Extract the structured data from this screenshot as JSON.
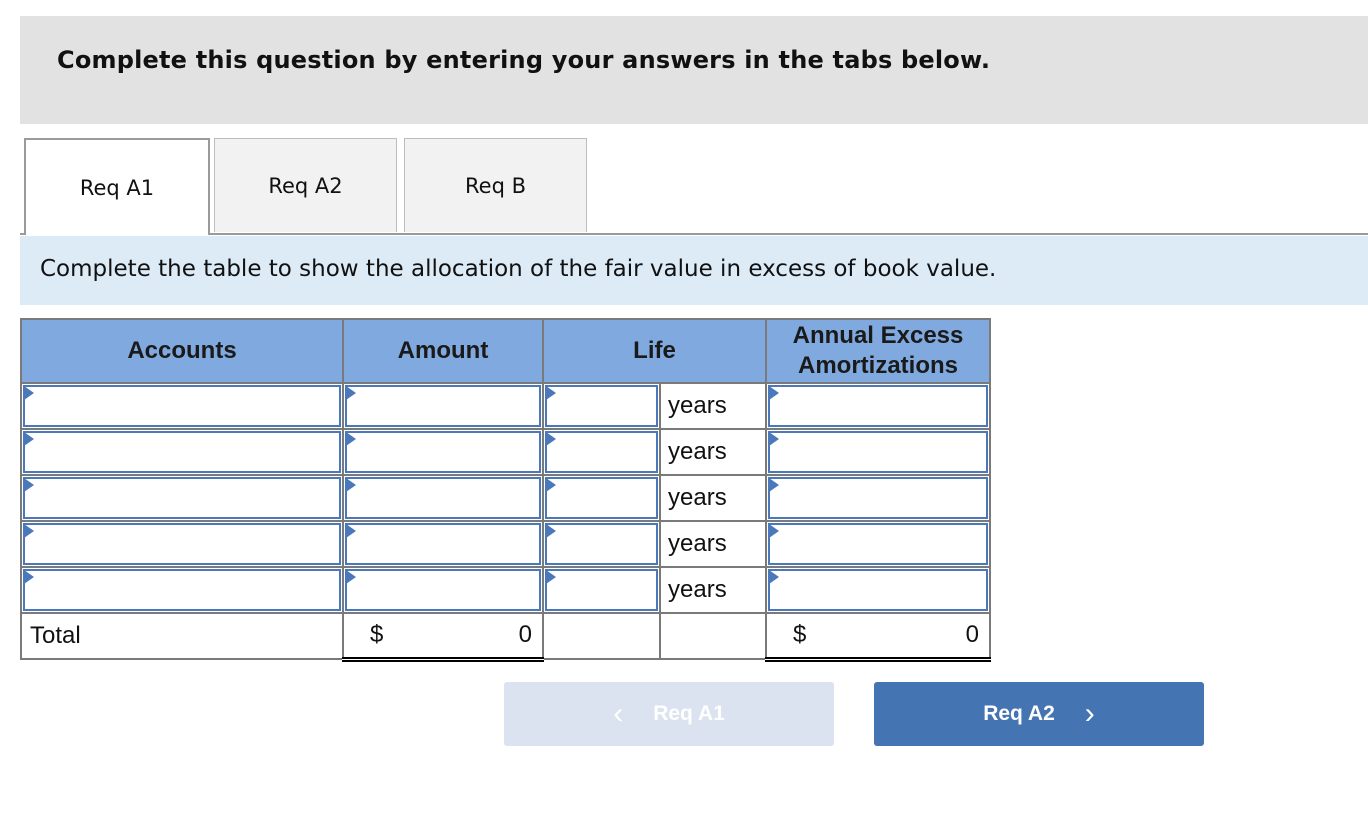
{
  "instructions": "Complete this question by entering your answers in the tabs below.",
  "tabs": [
    {
      "label": "Req A1",
      "active": true
    },
    {
      "label": "Req A2",
      "active": false
    },
    {
      "label": "Req B",
      "active": false
    }
  ],
  "prompt": "Complete the table to show the allocation of the fair value in excess of book value.",
  "table": {
    "headers": {
      "accounts": "Accounts",
      "amount": "Amount",
      "life": "Life",
      "annual_line1": "Annual Excess",
      "annual_line2": "Amortizations"
    },
    "rows": [
      {
        "account": "",
        "amount": "",
        "life": "",
        "unit": "years",
        "annual": ""
      },
      {
        "account": "",
        "amount": "",
        "life": "",
        "unit": "years",
        "annual": ""
      },
      {
        "account": "",
        "amount": "",
        "life": "",
        "unit": "years",
        "annual": ""
      },
      {
        "account": "",
        "amount": "",
        "life": "",
        "unit": "years",
        "annual": ""
      },
      {
        "account": "",
        "amount": "",
        "life": "",
        "unit": "years",
        "annual": ""
      }
    ],
    "total": {
      "label": "Total",
      "currency": "$",
      "amount": "0",
      "annual": "0"
    }
  },
  "nav": {
    "prev_label": "Req A1",
    "next_label": "Req A2",
    "prev_icon": "chevron-left-icon",
    "next_icon": "chevron-right-icon"
  },
  "colors": {
    "header_bg": "#80aadf",
    "prompt_bg": "#ddebf7",
    "accent": "#4574b3",
    "disabled_button": "#dae3ef"
  }
}
